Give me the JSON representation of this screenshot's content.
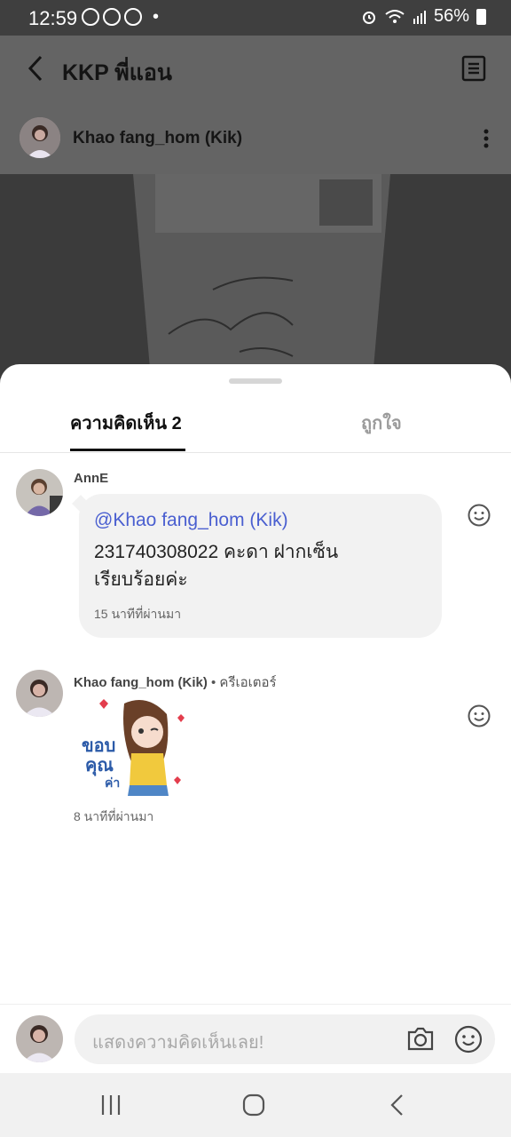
{
  "status_bar": {
    "time": "12:59",
    "dot": "•",
    "battery_percent": "56%"
  },
  "header": {
    "title": "KKP พี่แอน"
  },
  "post_author": {
    "name": "Khao fang_hom (Kik)"
  },
  "tabs": [
    {
      "label": "ความคิดเห็น 2",
      "active": true
    },
    {
      "label": "ถูกใจ",
      "active": false
    }
  ],
  "comments": [
    {
      "author": "AnnE",
      "mention": "@Khao fang_hom (Kik)",
      "text_line1": "231740308022 คะดา ฝากเซ็น",
      "text_line2": "เรียบร้อยค่ะ",
      "time": "15 นาทีที่ผ่านมา"
    },
    {
      "author": "Khao fang_hom (Kik)",
      "role": "• ครีเอเตอร์",
      "sticker_text_1": "ขอบ",
      "sticker_text_2": "คุณ",
      "sticker_text_3": "ค่า",
      "time": "8 นาทีที่ผ่านมา"
    }
  ],
  "composer": {
    "placeholder": "แสดงความคิดเห็นเลย!"
  },
  "colors": {
    "mention": "#4a5fd0",
    "accent_text": "#111111"
  },
  "icons": [
    "back-icon",
    "document-icon",
    "more-icon",
    "smiley-icon",
    "camera-icon",
    "recent-apps-icon",
    "home-icon",
    "nav-back-icon"
  ]
}
